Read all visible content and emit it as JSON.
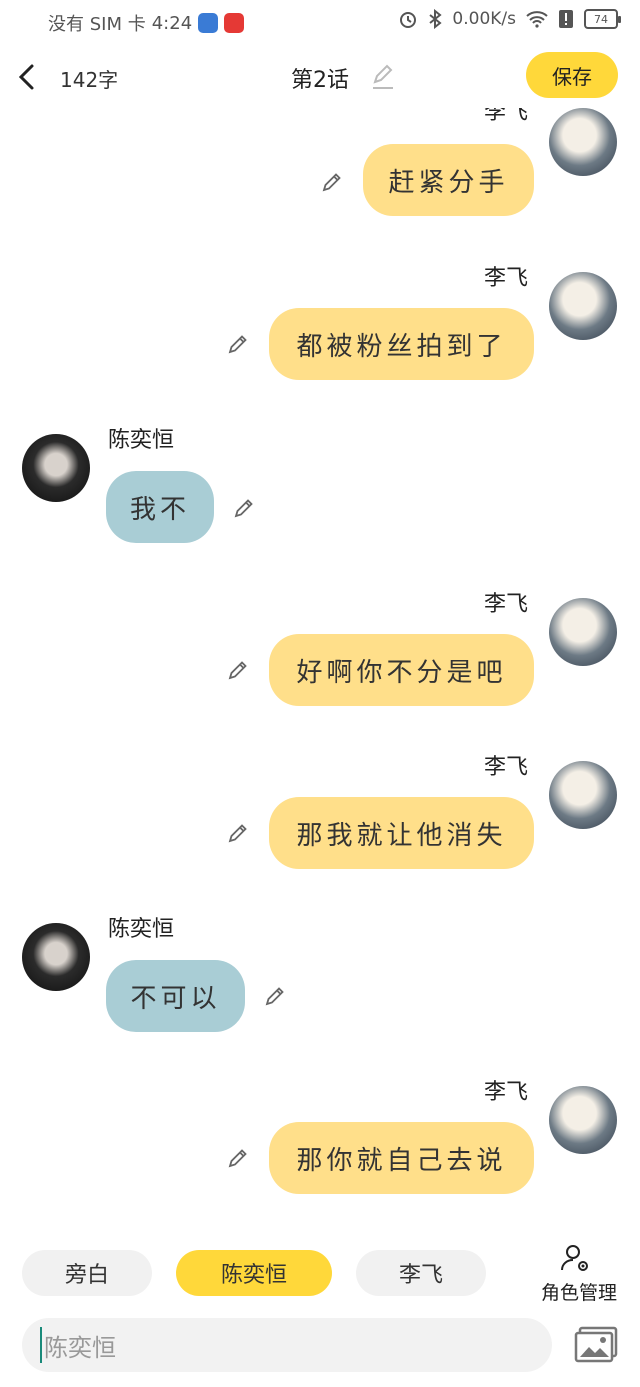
{
  "status_bar": {
    "carrier": "没有 SIM 卡",
    "time": "4:24",
    "net_speed": "0.00K/s",
    "battery": "74",
    "icons": [
      "alarm-icon",
      "bluetooth-icon",
      "wifi-icon",
      "alert-icon",
      "battery-icon"
    ]
  },
  "header": {
    "word_count": "142字",
    "title": "第2话",
    "save_label": "保存"
  },
  "messages": [
    {
      "speaker": "李飞",
      "text": "赶紧分手",
      "side": "right"
    },
    {
      "speaker": "李飞",
      "text": "都被粉丝拍到了",
      "side": "right"
    },
    {
      "speaker": "陈奕恒",
      "text": "我不",
      "side": "left"
    },
    {
      "speaker": "李飞",
      "text": "好啊你不分是吧",
      "side": "right"
    },
    {
      "speaker": "李飞",
      "text": "那我就让他消失",
      "side": "right"
    },
    {
      "speaker": "陈奕恒",
      "text": "不可以",
      "side": "left"
    },
    {
      "speaker": "李飞",
      "text": "那你就自己去说",
      "side": "right"
    }
  ],
  "roles": {
    "narration": "旁白",
    "chen": "陈奕恒",
    "li": "李飞",
    "manage_label": "角色管理",
    "active": "陈奕恒"
  },
  "input": {
    "placeholder": "陈奕恒"
  },
  "colors": {
    "accent_yellow": "#ffd83a",
    "bubble_right": "#ffdf8a",
    "bubble_left": "#a9cdd5"
  }
}
